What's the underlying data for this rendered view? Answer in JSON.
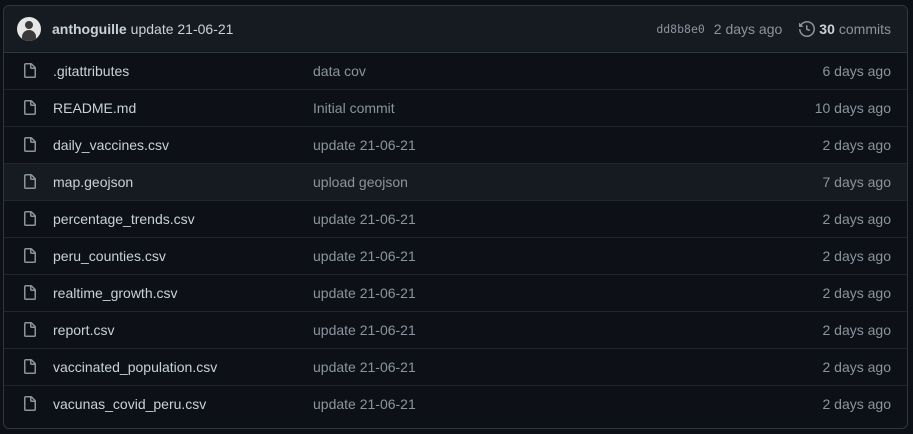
{
  "commit": {
    "author": "anthoguille",
    "message": "update 21-06-21",
    "sha": "dd8b8e0",
    "age": "2 days ago",
    "commits_count": "30",
    "commits_label": "commits"
  },
  "files": [
    {
      "name": ".gitattributes",
      "message": "data cov",
      "age": "6 days ago"
    },
    {
      "name": "README.md",
      "message": "Initial commit",
      "age": "10 days ago"
    },
    {
      "name": "daily_vaccines.csv",
      "message": "update 21-06-21",
      "age": "2 days ago"
    },
    {
      "name": "map.geojson",
      "message": "upload geojson",
      "age": "7 days ago"
    },
    {
      "name": "percentage_trends.csv",
      "message": "update 21-06-21",
      "age": "2 days ago"
    },
    {
      "name": "peru_counties.csv",
      "message": "update 21-06-21",
      "age": "2 days ago"
    },
    {
      "name": "realtime_growth.csv",
      "message": "update 21-06-21",
      "age": "2 days ago"
    },
    {
      "name": "report.csv",
      "message": "update 21-06-21",
      "age": "2 days ago"
    },
    {
      "name": "vaccinated_population.csv",
      "message": "update 21-06-21",
      "age": "2 days ago"
    },
    {
      "name": "vacunas_covid_peru.csv",
      "message": "update 21-06-21",
      "age": "2 days ago"
    }
  ],
  "colors": {
    "background": "#0d1117",
    "header_background": "#161b22",
    "border": "#30363d",
    "text": "#c9d1d9",
    "muted": "#8b949e"
  }
}
